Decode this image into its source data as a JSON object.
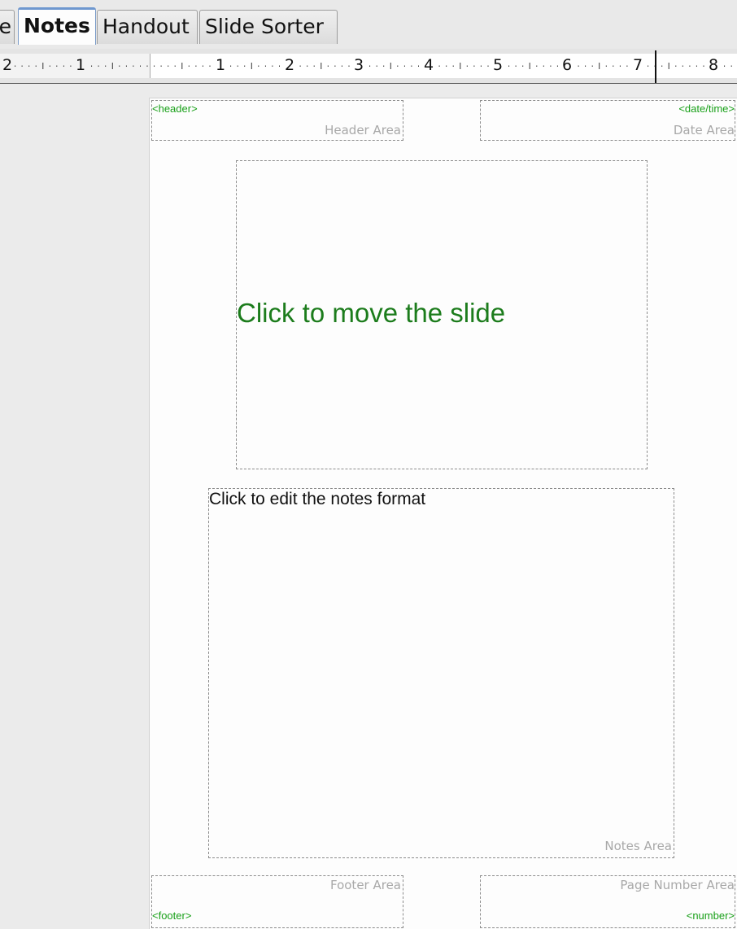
{
  "tabs": [
    {
      "label": "e",
      "active": false
    },
    {
      "label": "Notes",
      "active": true
    },
    {
      "label": "Handout",
      "active": false
    },
    {
      "label": "Slide Sorter",
      "active": false
    }
  ],
  "ruler": {
    "labels_left": [
      "2",
      "1"
    ],
    "labels_right": [
      "1",
      "2",
      "3",
      "4",
      "5",
      "6",
      "7",
      "8"
    ]
  },
  "page": {
    "header": {
      "field": "<header>",
      "label": "Header Area"
    },
    "date": {
      "field": "<date/time>",
      "label": "Date Area"
    },
    "slide": {
      "text": "Click to move the slide"
    },
    "notes": {
      "text": "Click to edit the notes format",
      "label": "Notes Area"
    },
    "footer": {
      "field": "<footer>",
      "label": "Footer Area"
    },
    "page_number": {
      "field": "<number>",
      "label": "Page Number Area"
    }
  },
  "colors": {
    "field_green": "#19a019",
    "slide_text_green": "#1c7c1c",
    "area_label_grey": "#a8a8a8",
    "active_tab_accent": "#6e97cf"
  }
}
